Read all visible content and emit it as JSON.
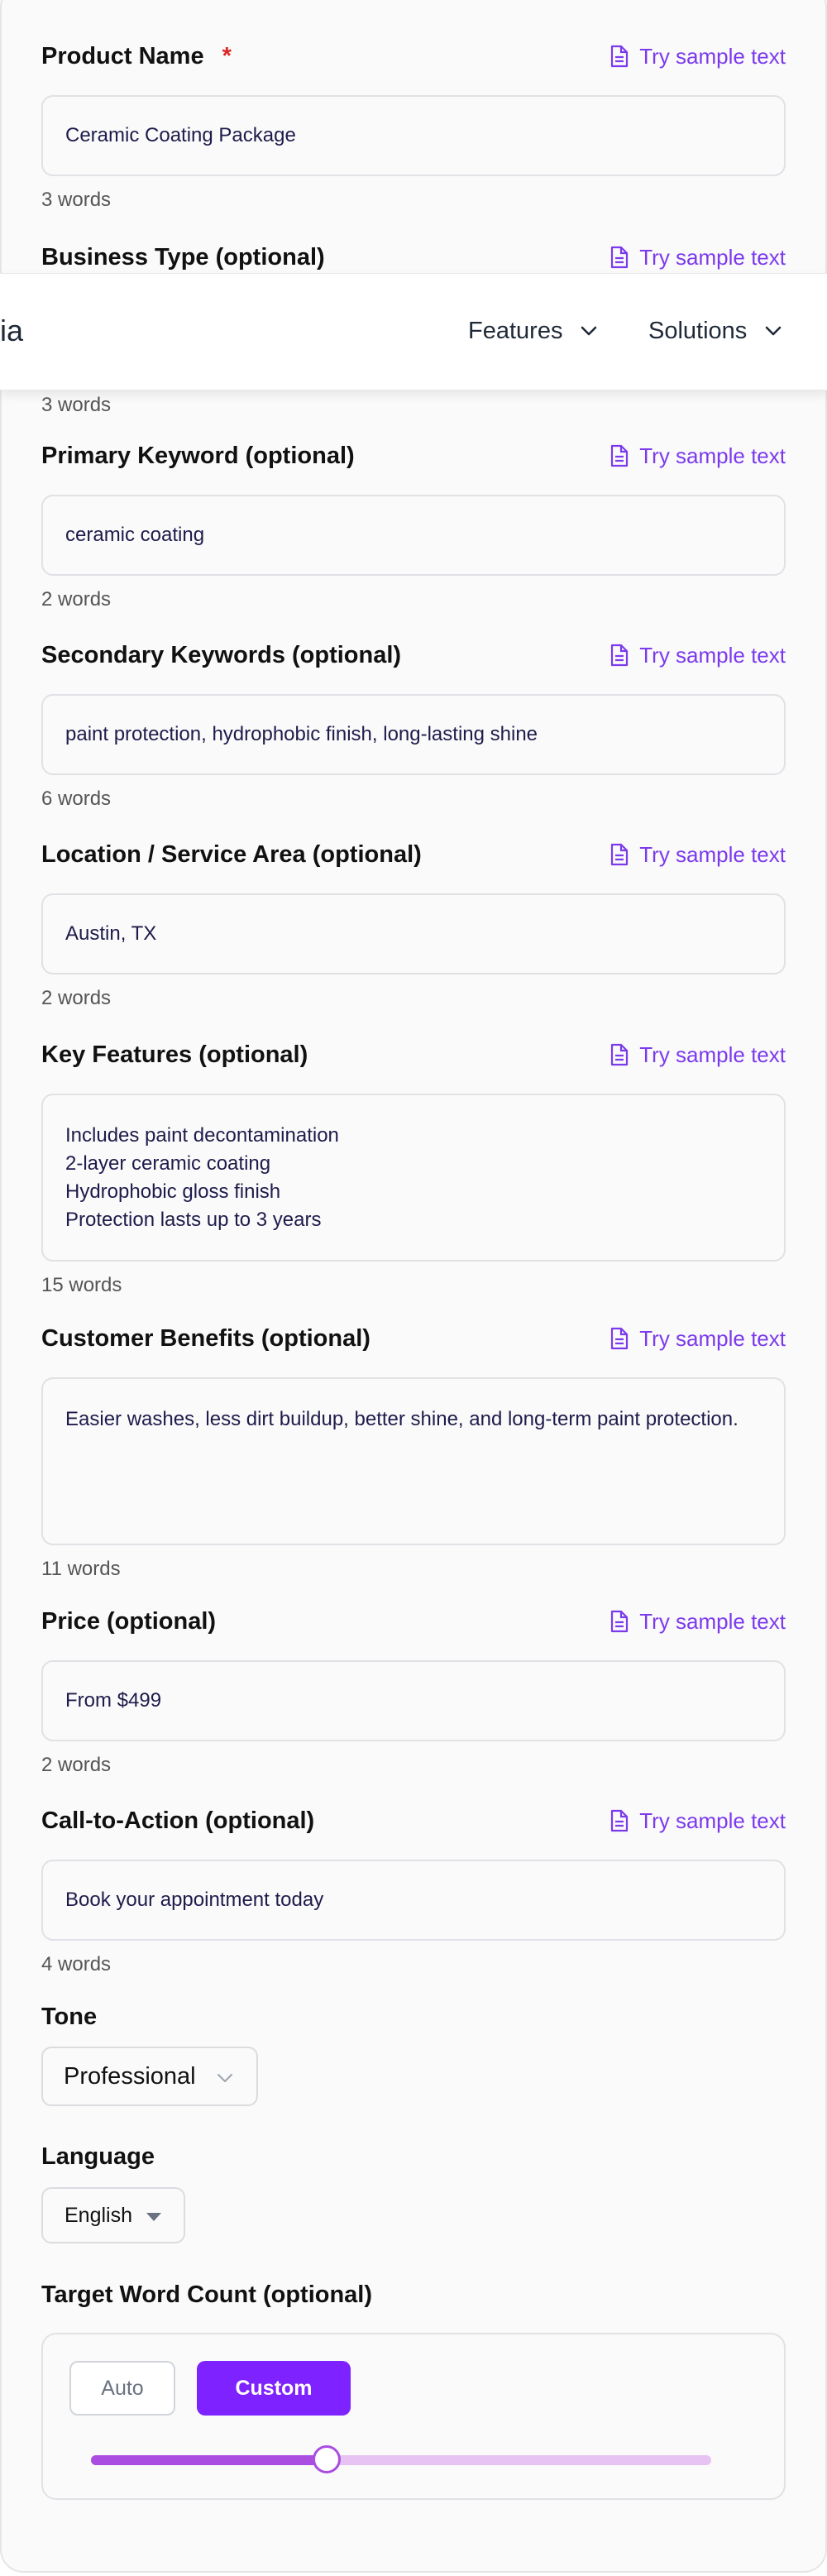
{
  "sample_link_label": "Try sample text",
  "fields": [
    {
      "label": "Product Name",
      "required_mark": "*",
      "value": "Ceramic Coating Package",
      "count": "3 words"
    },
    {
      "label": "Business Type (optional)"
    },
    {
      "count": "3 words"
    },
    {
      "label": "Primary Keyword (optional)",
      "value": "ceramic coating",
      "count": "2 words"
    },
    {
      "label": "Secondary Keywords (optional)",
      "value": "paint protection, hydrophobic finish, long-lasting shine",
      "count": "6 words"
    },
    {
      "label": "Location / Service Area (optional)",
      "value": "Austin, TX",
      "count": "2 words"
    },
    {
      "label": "Key Features (optional)",
      "value": "Includes paint decontamination\n2-layer ceramic coating\nHydrophobic gloss finish\nProtection lasts up to 3 years",
      "count": "15 words"
    },
    {
      "label": "Customer Benefits (optional)",
      "value": "Easier washes, less dirt buildup, better shine, and long-term paint protection.",
      "count": "11 words"
    },
    {
      "label": "Price (optional)",
      "value": "From $499",
      "count": "2 words"
    },
    {
      "label": "Call-to-Action (optional)",
      "value": "Book your appointment today",
      "count": "4 words"
    }
  ],
  "navbar": {
    "logo_fragment": "ia",
    "items": [
      {
        "label": "Features"
      },
      {
        "label": "Solutions"
      }
    ]
  },
  "tone": {
    "label": "Tone",
    "selected": "Professional"
  },
  "language": {
    "label": "Language",
    "selected": "English"
  },
  "word_count": {
    "label": "Target Word Count (optional)",
    "auto_label": "Auto",
    "custom_label": "Custom",
    "active_mode": "custom",
    "slider_fraction": 0.38
  },
  "colors": {
    "accent": "#7e22ff",
    "link": "#7c3aed",
    "required": "#dc2626",
    "slider_fill": "#a94ee0",
    "slider_track": "#e6c3f2"
  },
  "icons": {
    "sample": "document-icon",
    "nav_dropdown": "chevron-down-icon",
    "tone_dropdown": "chevron-down-icon",
    "language_dropdown": "caret-down-icon"
  }
}
